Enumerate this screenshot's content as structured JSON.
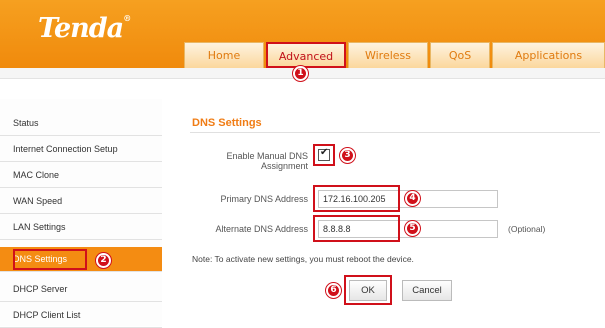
{
  "brand": {
    "logo": "Tenda",
    "reg": "®"
  },
  "nav": {
    "tabs": [
      "Home",
      "Advanced",
      "Wireless",
      "QoS",
      "Applications"
    ],
    "active": "Advanced"
  },
  "sidebar": {
    "items": [
      "Status",
      "Internet Connection Setup",
      "MAC Clone",
      "WAN Speed",
      "LAN Settings",
      "DNS Settings",
      "DHCP Server",
      "DHCP Client List"
    ],
    "active": "DNS Settings"
  },
  "dns": {
    "title": "DNS Settings",
    "enable_label_line1": "Enable Manual DNS",
    "enable_label_line2": "Assignment",
    "enable_checked": true,
    "primary_label": "Primary DNS Address",
    "primary_value": "172.16.100.205",
    "alternate_label": "Alternate DNS Address",
    "alternate_value": "8.8.8.8",
    "optional": "(Optional)",
    "note": "Note: To activate new settings, you must reboot the device.",
    "ok": "OK",
    "cancel": "Cancel"
  },
  "steps": [
    "1",
    "2",
    "3",
    "4",
    "5",
    "6"
  ],
  "colors": {
    "brand_orange": "#f08a0c",
    "highlight_red": "#d0101a",
    "title_orange": "#f07c14"
  }
}
